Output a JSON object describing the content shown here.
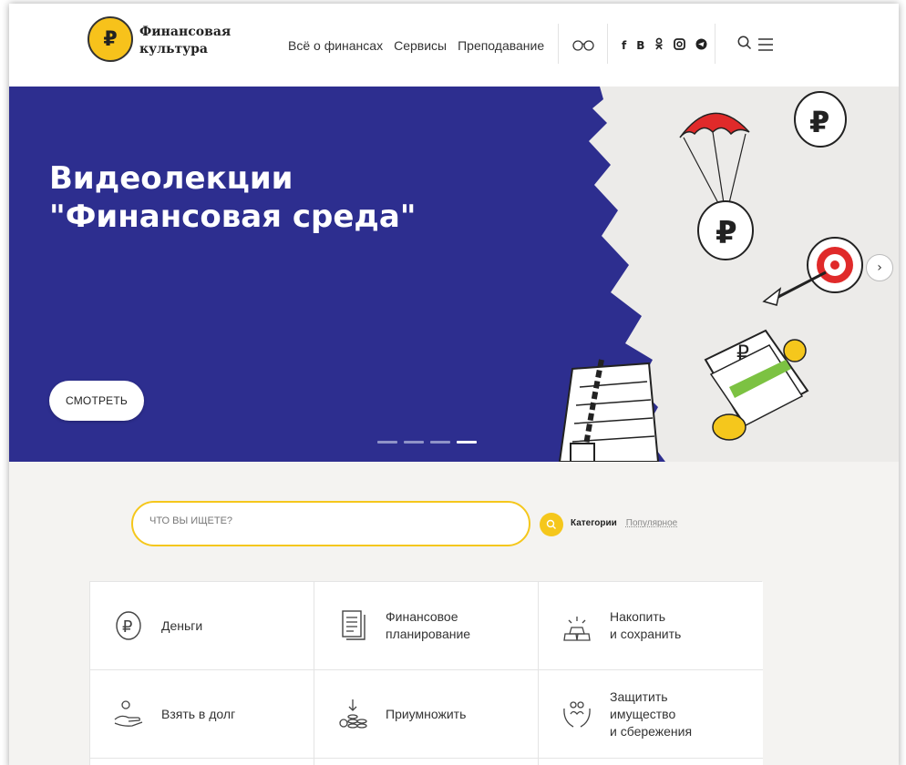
{
  "header": {
    "logo_symbol": "₽",
    "logo_text": "Финансовая\nкультура",
    "nav": [
      {
        "label": "Всё о финансах"
      },
      {
        "label": "Сервисы"
      },
      {
        "label": "Преподавание"
      }
    ],
    "accessibility_glyph": "oo",
    "social": [
      {
        "label": "f",
        "icon": "facebook-icon"
      },
      {
        "label": "В",
        "icon": "vk-icon"
      },
      {
        "label": "ok",
        "icon": "odnoklassniki-icon"
      },
      {
        "label": "ig",
        "icon": "instagram-icon"
      },
      {
        "label": "tg",
        "icon": "telegram-icon"
      }
    ]
  },
  "hero": {
    "title_line1": "Видеолекции",
    "title_line2": "\"Финансовая среда\"",
    "button_label": "СМОТРЕТЬ",
    "slides": 4,
    "active_slide": 4,
    "colors": {
      "blue": "#2d2e8f",
      "accent": "#f5c71c",
      "red": "#e02a2a"
    }
  },
  "search": {
    "placeholder": "ЧТО ВЫ ИЩЕТЕ?",
    "tab_categories": "Категории",
    "tab_popular": "Популярное"
  },
  "categories": [
    {
      "label": "Деньги",
      "icon": "ruble-icon"
    },
    {
      "label": "Финансовое\nпланирование",
      "icon": "document-icon"
    },
    {
      "label": "Накопить\nи сохранить",
      "icon": "gold-bars-icon"
    },
    {
      "label": "Взять в долг",
      "icon": "hand-coin-icon"
    },
    {
      "label": "Приумножить",
      "icon": "coins-stack-icon"
    },
    {
      "label": "Защитить\nимущество\nи сбережения",
      "icon": "protect-hands-icon"
    }
  ]
}
